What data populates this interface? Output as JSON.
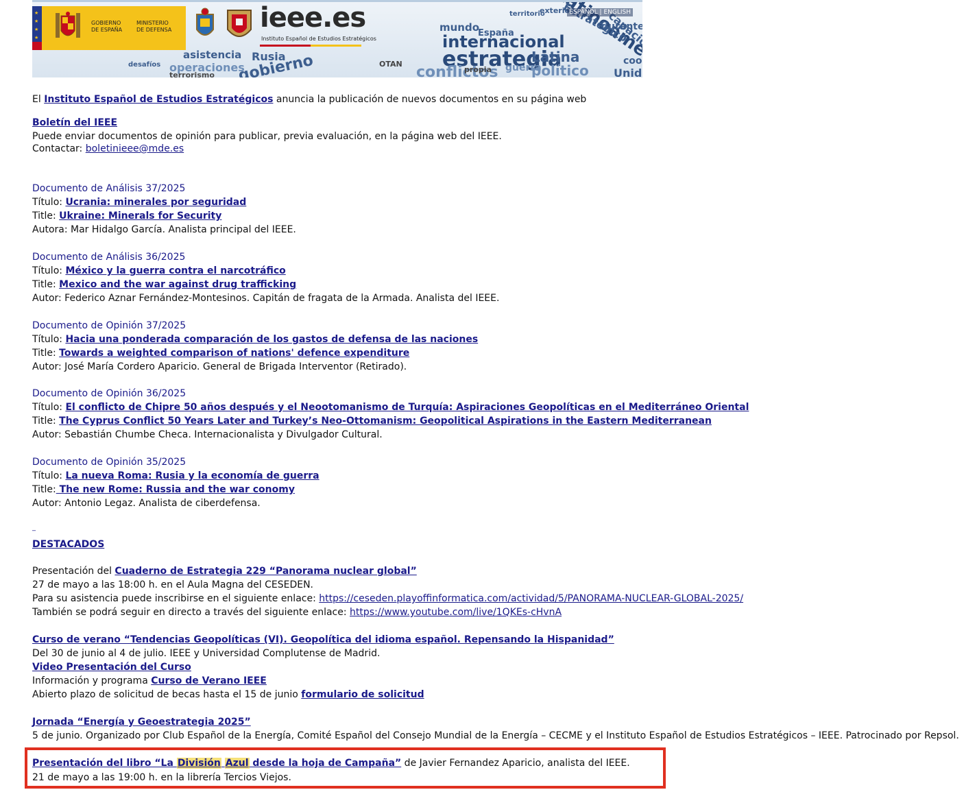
{
  "banner": {
    "gov_text": [
      "GOBIERNO",
      "DE ESPAÑA"
    ],
    "ministry_text": [
      "MINISTERIO",
      "DE DEFENSA"
    ],
    "logo": "ieee.es",
    "logo_sub": "Instituto Español de Estudios Estratégicos",
    "lang_es": "ESPAÑOL",
    "lang_sep": "|",
    "lang_en": "ENGLISH",
    "cloud_words": [
      "asistencia",
      "Rusia",
      "operaciones",
      "gobierno",
      "desafíos",
      "terrorismo",
      "mundo",
      "España",
      "internacional",
      "estrategia",
      "Latinoamérica",
      "Estratégico",
      "conflictos",
      "guerra",
      "político",
      "territorio",
      "exterior",
      "capacidades",
      "durante",
      "Latina",
      "propia",
      "OTAN",
      "coop",
      "Unido"
    ]
  },
  "intro": {
    "prefix": "El ",
    "institute_link": "Instituto Español de Estudios Estratégicos",
    "suffix": " anuncia la publicación de nuevos documentos en su página web"
  },
  "bulletin": {
    "title": "Boletín del IEEE",
    "text": "Puede enviar documentos de opinión para publicar, previa evaluación, en la página web del IEEE.",
    "contact_label": "Contactar: ",
    "contact_email": "boletinieee@mde.es"
  },
  "documents": [
    {
      "heading": "Documento de Análisis 37/2025",
      "titulo_label": "Título: ",
      "titulo": "Ucrania: minerales por seguridad",
      "title_label": "Title: ",
      "title": "Ukraine: Minerals for Security",
      "author": "Autora: Mar Hidalgo García. Analista principal del IEEE."
    },
    {
      "heading": "Documento de Análisis 36/2025",
      "titulo_label": "Título: ",
      "titulo": "México y la guerra contra el narcotráfico",
      "title_label": "Title: ",
      "title": "Mexico and the war against drug trafficking",
      "author": "Autor: Federico Aznar Fernández-Montesinos. Capitán de fragata de la Armada. Analista del IEEE."
    },
    {
      "heading": "Documento de Opinión 37/2025",
      "titulo_label": "Título: ",
      "titulo": "Hacia una ponderada comparación de los gastos de defensa de las naciones",
      "title_label": "Title: ",
      "title": "Towards a weighted comparison of nations' defence expenditure",
      "author": "Autor: José María Cordero Aparicio. General de Brigada Interventor (Retirado)."
    },
    {
      "heading": "Documento de Opinión 36/2025",
      "titulo_label": "Título: ",
      "titulo": "El conflicto de Chipre 50 años después y el Neootomanismo de Turquía: Aspiraciones Geopolíticas en el Mediterráneo Oriental",
      "title_label": "Title: ",
      "title": "The Cyprus Conflict 50 Years Later and Turkey’s Neo-Ottomanism: Geopolitical Aspirations in the Eastern Mediterranean",
      "author": "Autor: Sebastián Chumbe Checa. Internacionalista y Divulgador Cultural."
    },
    {
      "heading": "Documento de Opinión 35/2025",
      "titulo_label": "Título: ",
      "titulo": "La nueva Roma: Rusia y la economía de guerra",
      "title_label": "Title:",
      "title": " The new Rome: Russia and the war conomy",
      "author": "Autor: Antonio Legaz. Analista de ciberdefensa."
    }
  ],
  "destacados": {
    "dot": "_",
    "title": "DESTACADOS",
    "presentacion": {
      "prefix": "Presentación del ",
      "link": "Cuaderno de Estrategia 229 “Panorama nuclear global”",
      "date": "27 de mayo a las 18:00 h. en el Aula Magna del CESEDEN.",
      "register_prefix": "Para su asistencia puede inscribirse en el siguiente enlace: ",
      "register_url": "https://ceseden.playoffinformatica.com/actividad/5/PANORAMA-NUCLEAR-GLOBAL-2025/",
      "live_prefix": "También se podrá seguir en directo a través del siguiente enlace: ",
      "live_url": "https://www.youtube.com/live/1QKEs-cHvnA"
    },
    "curso": {
      "link": "Curso de verano “Tendencias Geopolíticas (VI). Geopolítica del idioma español. Repensando la Hispanidad”",
      "dates": "Del 30 de junio al 4 de julio. IEEE y Universidad Complutense de Madrid.",
      "video_link": "Video Presentación del Curso",
      "info_prefix": "Información y programa ",
      "info_link": "Curso de Verano IEEE",
      "becas_prefix": "Abierto plazo de solicitud de becas hasta el 15 de junio ",
      "becas_link": "formulario de solicitud"
    },
    "jornada": {
      "link": "Jornada “Energía y Geoestrategia 2025”",
      "text": "5 de junio. Organizado por Club Español de la Energía, Comité Español del Consejo Mundial de la Energía – CECME y el Instituto Español de Estudios Estratégicos – IEEE. Patrocinado por Repsol."
    },
    "libro": {
      "link_prefix": "Presentación del libro “La ",
      "link_highlight_1": "División",
      "link_space": " ",
      "link_highlight_2": "Azul",
      "link_suffix": " desde la hoja de Campaña”",
      "by": " de Javier Fernandez Aparicio, analista del IEEE.",
      "date": "21 de mayo a las 19:00 h. en la librería Tercios Viejos."
    }
  },
  "colors": {
    "link": "#1a1a8a",
    "highlight_border": "#e03020",
    "highlight_mark": "#f5e07a",
    "gov_yellow": "#f4c21a"
  }
}
